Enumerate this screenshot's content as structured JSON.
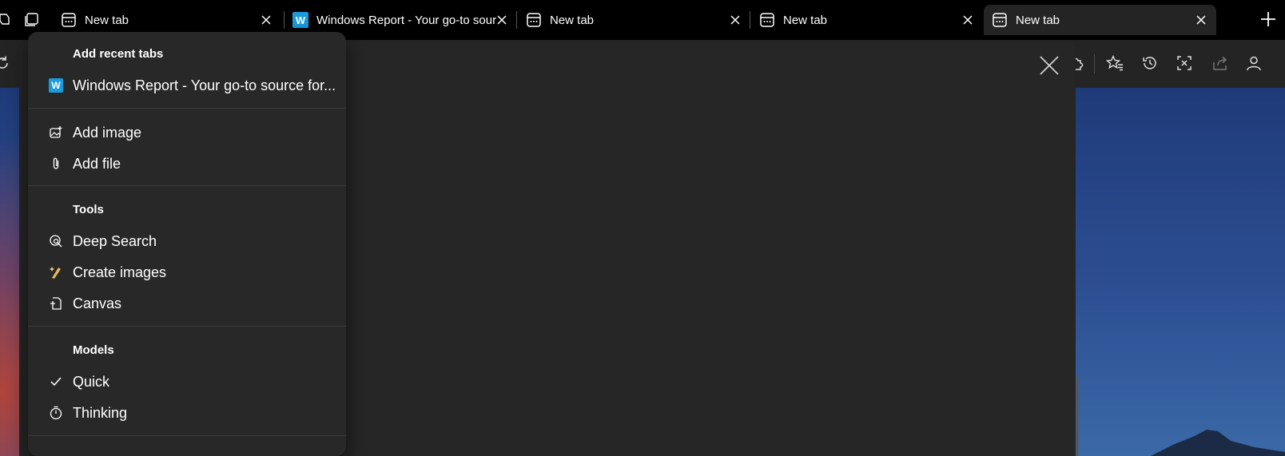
{
  "tabs": [
    {
      "title": "New tab",
      "icon": "new-tab-page-icon"
    },
    {
      "title": "Windows Report - Your go-to source",
      "icon": "windows-report-favicon"
    },
    {
      "title": "New tab",
      "icon": "new-tab-page-icon"
    },
    {
      "title": "New tab",
      "icon": "new-tab-page-icon"
    },
    {
      "title": "New tab",
      "icon": "new-tab-page-icon",
      "active": true
    }
  ],
  "favicon_letter": "W",
  "menu": {
    "recent_header": "Add recent tabs",
    "recent_tab": "Windows Report - Your go-to source for...",
    "add_image": "Add image",
    "add_file": "Add file",
    "tools_header": "Tools",
    "deep_search": "Deep Search",
    "create_images": "Create images",
    "canvas": "Canvas",
    "models_header": "Models",
    "quick": "Quick",
    "thinking": "Thinking",
    "selected_model": "Quick"
  },
  "colors": {
    "accent_windows_report": "#1a9bdc",
    "menu_bg": "#282828",
    "panel_bg": "#262626",
    "tab_active": "#242424"
  }
}
